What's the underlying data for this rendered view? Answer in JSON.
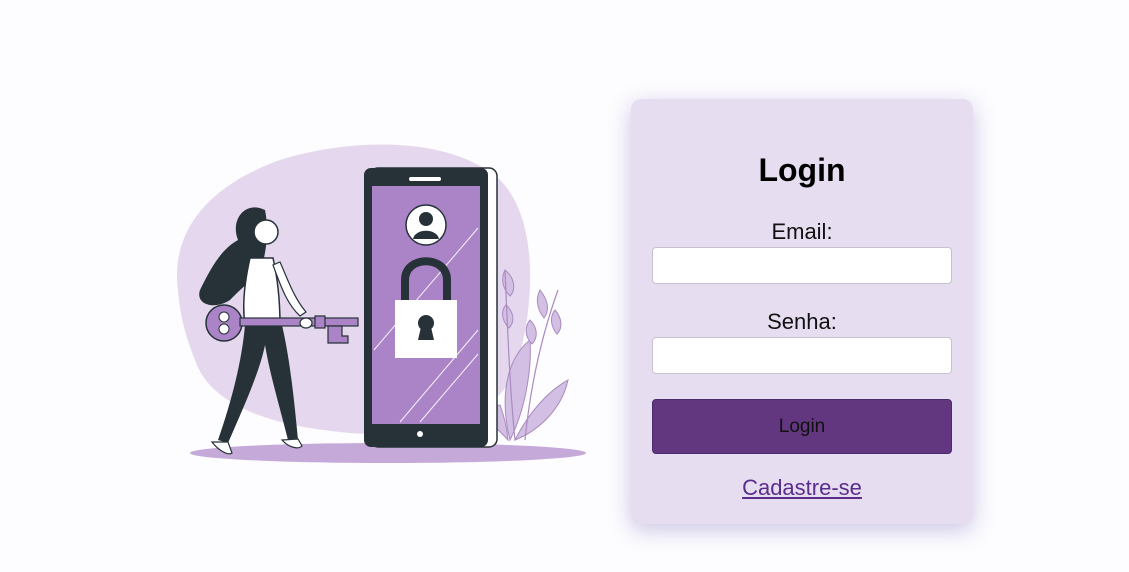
{
  "login_form": {
    "title": "Login",
    "email_label": "Email:",
    "email_value": "",
    "password_label": "Senha:",
    "password_value": "",
    "submit_label": "Login",
    "signup_link": "Cadastre-se"
  },
  "colors": {
    "page_background": "#fdfcfe",
    "card_background": "#e7ddf0",
    "button_background": "#62377f",
    "link": "#5a2d8c",
    "illustration_accent": "#aa84c6",
    "illustration_blob": "#e5d8ee",
    "illustration_dark": "#263238"
  },
  "illustration": {
    "icon": "woman-with-key-unlocking-phone-illustration"
  }
}
